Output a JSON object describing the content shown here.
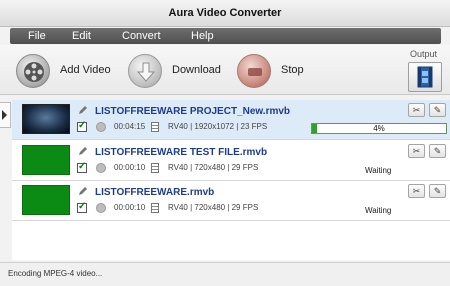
{
  "window": {
    "title": "Aura Video Converter"
  },
  "menu": [
    "File",
    "Edit",
    "Convert",
    "Help"
  ],
  "toolbar": {
    "add_video": "Add Video",
    "download": "Download",
    "stop": "Stop",
    "output_label": "Output",
    "icons": {
      "add_video": "film-reel-icon",
      "download": "download-arrow-icon",
      "stop": "stop-icon",
      "output": "film-strip-icon"
    }
  },
  "files": [
    {
      "name": "LISTOFFREEWARE PROJECT_New.rmvb",
      "duration": "00:04:15",
      "meta": "RV40 | 1920x1072 | 23 FPS",
      "checked": true,
      "progress": 4,
      "progress_label": "4%",
      "status": ""
    },
    {
      "name": "LISTOFFREEWARE TEST FILE.rmvb",
      "duration": "00:00:10",
      "meta": "RV40 | 720x480 | 29 FPS",
      "checked": true,
      "status": "Waiting"
    },
    {
      "name": "LISTOFFREEWARE.rmvb",
      "duration": "00:00:10",
      "meta": "RV40 | 720x480 | 29 FPS",
      "checked": true,
      "status": "Waiting"
    }
  ],
  "status_bar": "Encoding MPEG-4 video...",
  "colors": {
    "accent_green": "#2fa12f",
    "title_blue": "#1f3c8a",
    "selected_row": "#dcebf7"
  }
}
